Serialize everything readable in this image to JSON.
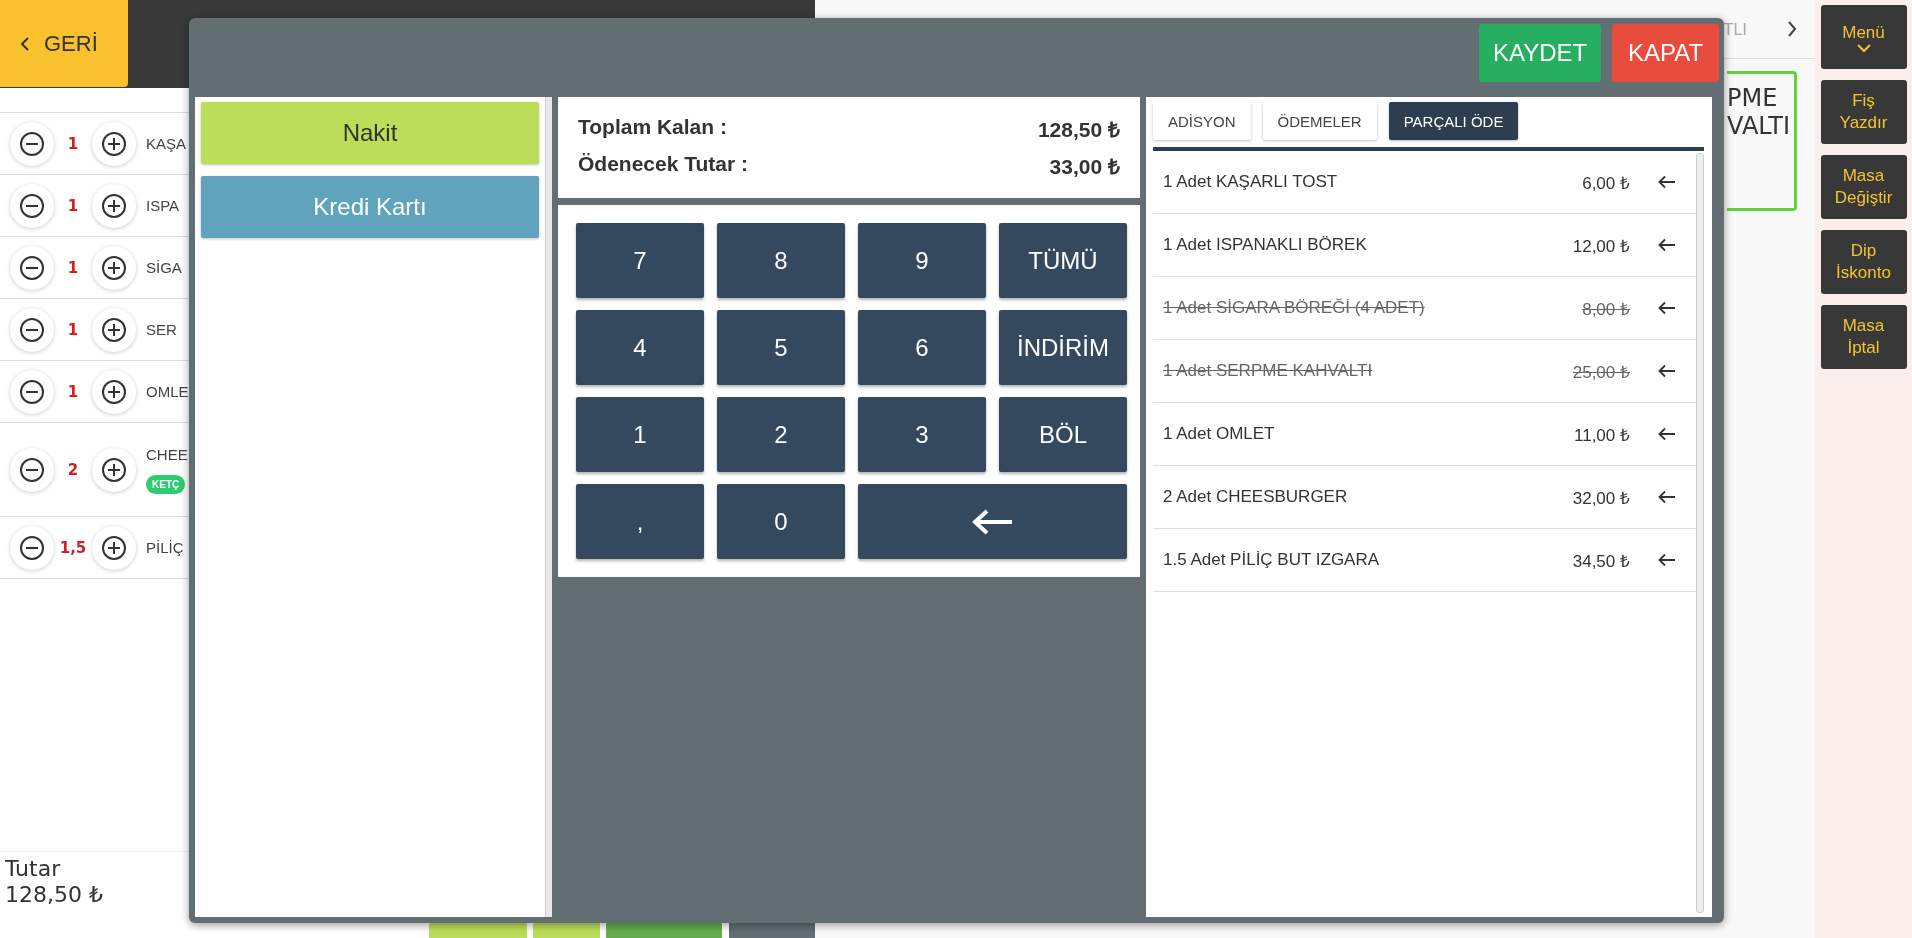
{
  "back_button": {
    "label": "GERİ"
  },
  "order_items": [
    {
      "quantity": "1",
      "name": "KAŞA"
    },
    {
      "quantity": "1",
      "name": "ISPA"
    },
    {
      "quantity": "1",
      "name": "SİGA"
    },
    {
      "quantity": "1",
      "name": "SER"
    },
    {
      "quantity": "1",
      "name": "OMLE"
    },
    {
      "quantity": "2",
      "name": "CHEE",
      "tags": [
        "KETÇ"
      ]
    },
    {
      "quantity": "1,5",
      "name": "PİLİÇ"
    }
  ],
  "total": {
    "label": "Tutar",
    "value": "128,50 ₺"
  },
  "background_tab": {
    "label": "TLI"
  },
  "table_card": {
    "lines": [
      "PME",
      "VALTI"
    ]
  },
  "side_menu": [
    {
      "lines": [
        "Menü"
      ],
      "kind": "dropdown"
    },
    {
      "lines": [
        "Fiş",
        "Yazdır"
      ],
      "kind": "action"
    },
    {
      "lines": [
        "Masa",
        "Değiştir"
      ],
      "kind": "action"
    },
    {
      "lines": [
        "Dip",
        "İskonto"
      ],
      "kind": "action"
    },
    {
      "lines": [
        "Masa",
        "İptal"
      ],
      "kind": "action"
    }
  ],
  "payment_dialog": {
    "buttons": [
      {
        "label": "KAYDET",
        "kind": "save"
      },
      {
        "label": "KAPAT",
        "kind": "close"
      }
    ],
    "payment_methods": [
      {
        "label": "Nakit",
        "color": "#bcdd5a"
      },
      {
        "label": "Kredi Kartı",
        "color": "#5fa3bd"
      }
    ],
    "summary": [
      {
        "label": "Toplam Kalan :",
        "value": "128,50 ₺"
      },
      {
        "label": "Ödenecek Tutar :",
        "value": "33,00 ₺"
      }
    ],
    "keypad": [
      {
        "kind": "key",
        "label": "7"
      },
      {
        "kind": "key",
        "label": "8"
      },
      {
        "kind": "key",
        "label": "9"
      },
      {
        "kind": "key",
        "label": "TÜMÜ"
      },
      {
        "kind": "key",
        "label": "4"
      },
      {
        "kind": "key",
        "label": "5"
      },
      {
        "kind": "key",
        "label": "6"
      },
      {
        "kind": "key",
        "label": "İNDİRİM"
      },
      {
        "kind": "key",
        "label": "1"
      },
      {
        "kind": "key",
        "label": "2"
      },
      {
        "kind": "key",
        "label": "3"
      },
      {
        "kind": "key",
        "label": "BÖL"
      },
      {
        "kind": "key",
        "label": ","
      },
      {
        "kind": "key",
        "label": "0"
      },
      {
        "kind": "backspace"
      }
    ],
    "tabs": [
      {
        "label": "ADİSYON",
        "selected": false
      },
      {
        "label": "ÖDEMELER",
        "selected": false
      },
      {
        "label": "PARÇALI ÖDE",
        "selected": true
      }
    ],
    "items": [
      {
        "text": "1 Adet KAŞARLI TOST",
        "price": "6,00 ₺",
        "paid": false
      },
      {
        "text": "1 Adet ISPANAKLI BÖREK",
        "price": "12,00 ₺",
        "paid": false
      },
      {
        "text": "1 Adet SİGARA BÖREĞİ (4 ADET)",
        "price": "8,00 ₺",
        "paid": true
      },
      {
        "text": "1 Adet SERPME KAHVALTI",
        "price": "25,00 ₺",
        "paid": true
      },
      {
        "text": "1 Adet OMLET",
        "price": "11,00 ₺",
        "paid": false
      },
      {
        "text": "2 Adet CHEESBURGER",
        "price": "32,00 ₺",
        "paid": false
      },
      {
        "text": "1.5 Adet PİLİÇ BUT IZGARA",
        "price": "34,50 ₺",
        "paid": false
      }
    ]
  }
}
